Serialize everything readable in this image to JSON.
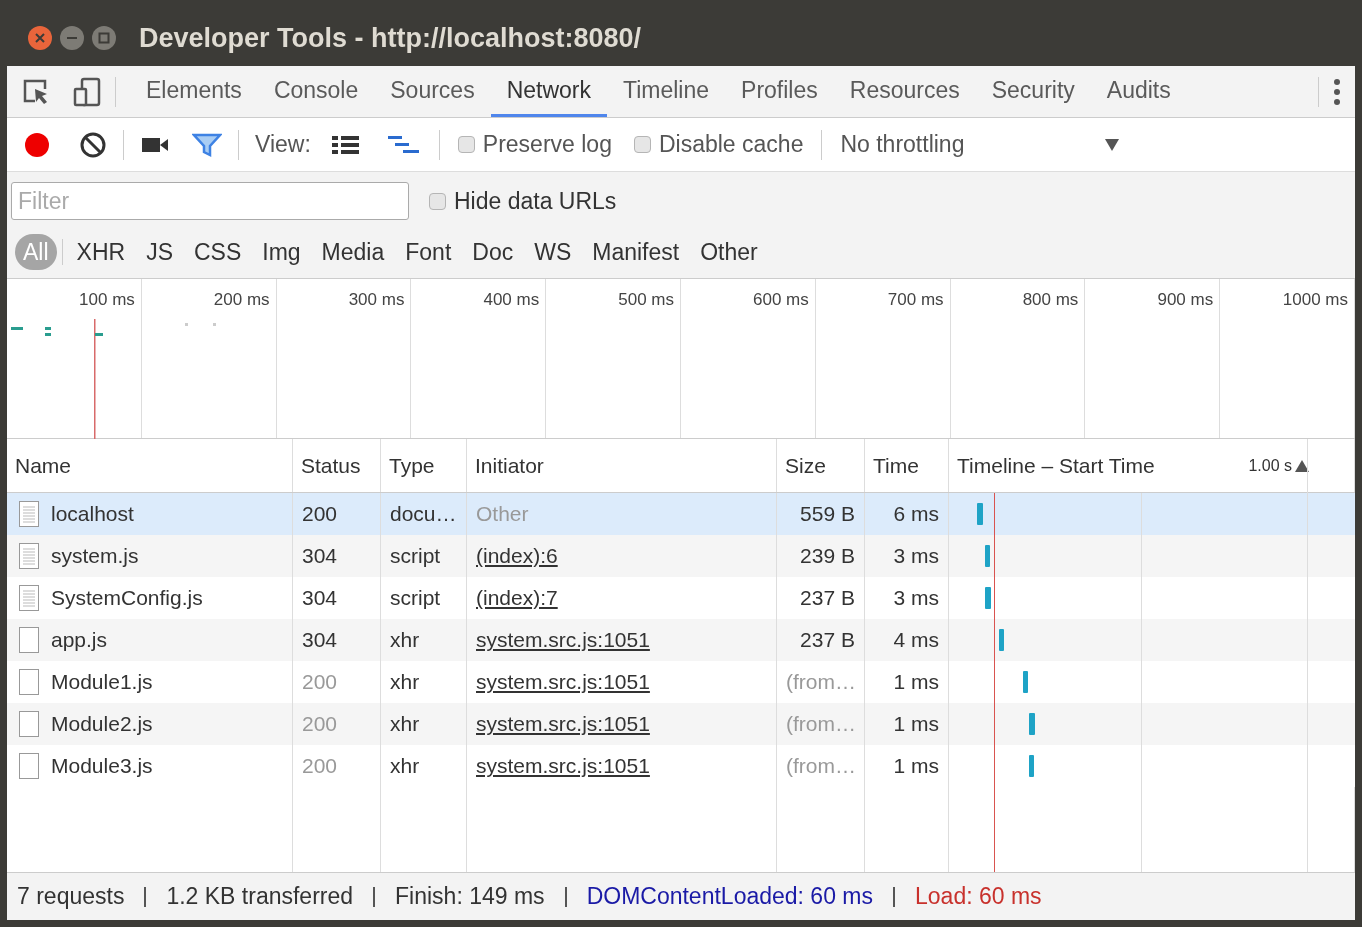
{
  "window": {
    "title": "Developer Tools - http://localhost:8080/"
  },
  "tabs": [
    {
      "label": "Elements",
      "selected": false
    },
    {
      "label": "Console",
      "selected": false
    },
    {
      "label": "Sources",
      "selected": false
    },
    {
      "label": "Network",
      "selected": true
    },
    {
      "label": "Timeline",
      "selected": false
    },
    {
      "label": "Profiles",
      "selected": false
    },
    {
      "label": "Resources",
      "selected": false
    },
    {
      "label": "Security",
      "selected": false
    },
    {
      "label": "Audits",
      "selected": false
    }
  ],
  "toolbar": {
    "recording": true,
    "filter_on": true,
    "view_label": "View:",
    "preserve_log": {
      "label": "Preserve log",
      "checked": false
    },
    "disable_cache": {
      "label": "Disable cache",
      "checked": false
    },
    "throttling": "No throttling"
  },
  "filter": {
    "placeholder": "Filter",
    "hide_data_urls": {
      "label": "Hide data URLs",
      "checked": false
    }
  },
  "types": [
    {
      "label": "All",
      "selected": true
    },
    {
      "label": "XHR",
      "selected": false
    },
    {
      "label": "JS",
      "selected": false
    },
    {
      "label": "CSS",
      "selected": false
    },
    {
      "label": "Img",
      "selected": false
    },
    {
      "label": "Media",
      "selected": false
    },
    {
      "label": "Font",
      "selected": false
    },
    {
      "label": "Doc",
      "selected": false
    },
    {
      "label": "WS",
      "selected": false
    },
    {
      "label": "Manifest",
      "selected": false
    },
    {
      "label": "Other",
      "selected": false
    }
  ],
  "overview": {
    "ticks": [
      "100 ms",
      "200 ms",
      "300 ms",
      "400 ms",
      "500 ms",
      "600 ms",
      "700 ms",
      "800 ms",
      "900 ms",
      "1000 ms"
    ]
  },
  "table": {
    "columns": [
      "Name",
      "Status",
      "Type",
      "Initiator",
      "Size",
      "Time",
      "Timeline – Start Time"
    ],
    "scale": "1.00 s",
    "rows": [
      {
        "name": "localhost",
        "kind": "document",
        "status": "200",
        "type": "docu…",
        "initiator": "Other",
        "initiator_linked": false,
        "size": "559 B",
        "time": "6 ms",
        "cached": false,
        "selected": true
      },
      {
        "name": "system.js",
        "kind": "document",
        "status": "304",
        "type": "script",
        "initiator": "(index):6",
        "initiator_linked": true,
        "size": "239 B",
        "time": "3 ms",
        "cached": false,
        "selected": false
      },
      {
        "name": "SystemConfig.js",
        "kind": "document",
        "status": "304",
        "type": "script",
        "initiator": "(index):7",
        "initiator_linked": true,
        "size": "237 B",
        "time": "3 ms",
        "cached": false,
        "selected": false
      },
      {
        "name": "app.js",
        "kind": "blank",
        "status": "304",
        "type": "xhr",
        "initiator": "system.src.js:1051",
        "initiator_linked": true,
        "size": "237 B",
        "time": "4 ms",
        "cached": false,
        "selected": false
      },
      {
        "name": "Module1.js",
        "kind": "blank",
        "status": "200",
        "type": "xhr",
        "initiator": "system.src.js:1051",
        "initiator_linked": true,
        "size": "(from…",
        "time": "1 ms",
        "cached": true,
        "selected": false
      },
      {
        "name": "Module2.js",
        "kind": "blank",
        "status": "200",
        "type": "xhr",
        "initiator": "system.src.js:1051",
        "initiator_linked": true,
        "size": "(from…",
        "time": "1 ms",
        "cached": true,
        "selected": false
      },
      {
        "name": "Module3.js",
        "kind": "blank",
        "status": "200",
        "type": "xhr",
        "initiator": "system.src.js:1051",
        "initiator_linked": true,
        "size": "(from…",
        "time": "1 ms",
        "cached": true,
        "selected": false
      }
    ]
  },
  "status_bar": [
    {
      "text": "7 requests",
      "color": "#333333"
    },
    {
      "text": "1.2 KB transferred",
      "color": "#333333"
    },
    {
      "text": "Finish: 149 ms",
      "color": "#333333"
    },
    {
      "text": "DOMContentLoaded: 60 ms",
      "color": "#1a1aa6"
    },
    {
      "text": "Load: 60 ms",
      "color": "#c8312c"
    }
  ]
}
